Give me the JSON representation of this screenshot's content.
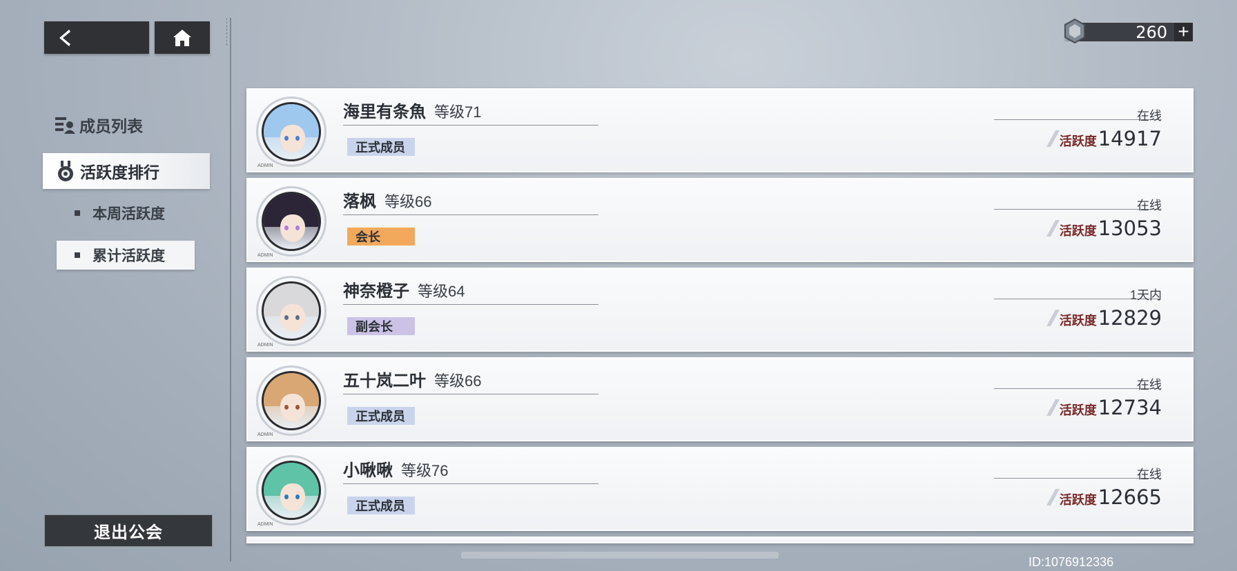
{
  "nav": {
    "back_icon": "back-arrow-icon",
    "home_icon": "home-icon"
  },
  "currency": {
    "icon": "crystal-icon",
    "amount": "260",
    "plus_label": "+"
  },
  "sidebar": {
    "member_list_label": "成员列表",
    "activity_rank_label": "活跃度排行",
    "weekly_label": "本周活跃度",
    "total_label": "累计活跃度",
    "quit_label": "退出公会"
  },
  "members": [
    {
      "name": "海里有条魚",
      "level": "等级71",
      "role": "正式成员",
      "role_color": "#c9d4ec",
      "status": "在线",
      "activity_label": "活跃度",
      "activity": "14917",
      "hair": "#9fc8ee",
      "eye": "#4a7fd0"
    },
    {
      "name": "落枫",
      "level": "等级66",
      "role": "会长",
      "role_color": "#f2a95b",
      "status": "在线",
      "activity_label": "活跃度",
      "activity": "13053",
      "hair": "#2c2538",
      "eye": "#b07ae0"
    },
    {
      "name": "神奈橙子",
      "level": "等级64",
      "role": "副会长",
      "role_color": "#cbc2e6",
      "status": "1天内",
      "activity_label": "活跃度",
      "activity": "12829",
      "hair": "#d9d9dc",
      "eye": "#5b6f8a"
    },
    {
      "name": "五十岚二叶",
      "level": "等级66",
      "role": "正式成员",
      "role_color": "#c9d4ec",
      "status": "在线",
      "activity_label": "活跃度",
      "activity": "12734",
      "hair": "#d8a774",
      "eye": "#9a5a3a"
    },
    {
      "name": "小啾啾",
      "level": "等级76",
      "role": "正式成员",
      "role_color": "#c9d4ec",
      "status": "在线",
      "activity_label": "活跃度",
      "activity": "12665",
      "hair": "#5fc3a8",
      "eye": "#2f7ab8"
    }
  ],
  "admin_tag": "ADMIN",
  "user_id": "ID:1076912336"
}
